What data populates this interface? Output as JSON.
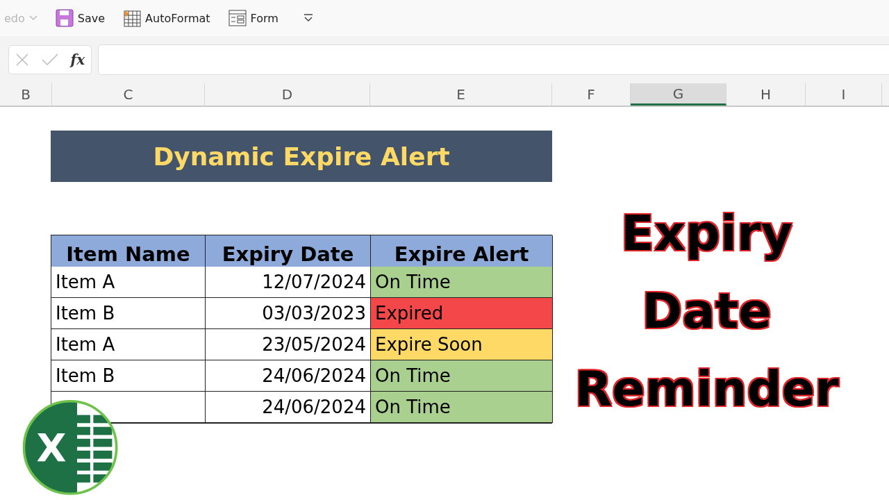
{
  "toolbar": {
    "items": [
      {
        "label": "edo",
        "disabled": true
      },
      {
        "label": "Save",
        "disabled": false
      },
      {
        "label": "AutoFormat",
        "disabled": false
      },
      {
        "label": "Form",
        "disabled": false
      }
    ]
  },
  "formula_bar": {
    "fx": "fx"
  },
  "column_headers": [
    {
      "label": "B",
      "selected": false
    },
    {
      "label": "C",
      "selected": false
    },
    {
      "label": "D",
      "selected": false
    },
    {
      "label": "E",
      "selected": false
    },
    {
      "label": "F",
      "selected": false
    },
    {
      "label": "G",
      "selected": true
    },
    {
      "label": "H",
      "selected": false
    },
    {
      "label": "I",
      "selected": false
    }
  ],
  "banner": {
    "title": "Dynamic Expire Alert"
  },
  "table": {
    "columns": [
      "Item Name",
      "Expiry Date",
      "Expire Alert"
    ],
    "rows": [
      {
        "name": "Item A",
        "date": "12/07/2024",
        "alert": "On Time",
        "color": "#a9d08e"
      },
      {
        "name": "Item B",
        "date": "03/03/2023",
        "alert": "Expired",
        "color": "#f4474a"
      },
      {
        "name": "Item A",
        "date": "23/05/2024",
        "alert": "Expire Soon",
        "color": "#ffd966"
      },
      {
        "name": "Item B",
        "date": "24/06/2024",
        "alert": "On Time",
        "color": "#a9d08e"
      },
      {
        "date": "24/06/2024",
        "alert": "On Time",
        "color": "#a9d08e"
      }
    ]
  },
  "headline": [
    "Expiry",
    "Date",
    "Reminder"
  ],
  "logo": {
    "letter": "X"
  }
}
